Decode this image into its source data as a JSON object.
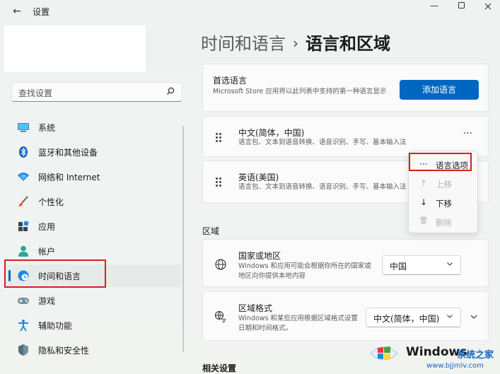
{
  "window": {
    "title": "设置",
    "back_glyph": "←",
    "min_glyph": "—"
  },
  "search": {
    "placeholder": "查找设置"
  },
  "sidebar": {
    "items": [
      {
        "label": "系统",
        "icon": "system-icon"
      },
      {
        "label": "蓝牙和其他设备",
        "icon": "bluetooth-icon"
      },
      {
        "label": "网络和 Internet",
        "icon": "wifi-icon"
      },
      {
        "label": "个性化",
        "icon": "brush-icon"
      },
      {
        "label": "应用",
        "icon": "apps-icon"
      },
      {
        "label": "帐户",
        "icon": "person-icon"
      },
      {
        "label": "时间和语言",
        "icon": "globe-clock-icon"
      },
      {
        "label": "游戏",
        "icon": "gamepad-icon"
      },
      {
        "label": "辅助功能",
        "icon": "accessibility-icon"
      },
      {
        "label": "隐私和安全性",
        "icon": "shield-icon"
      }
    ],
    "active_index": 6
  },
  "header": {
    "parent": "时间和语言",
    "separator": "›",
    "current": "语言和区域"
  },
  "preferred": {
    "title": "首选语言",
    "description": "Microsoft Store 应用将以此列表中支持的第一种语言显示",
    "add_button": "添加语言"
  },
  "languages": [
    {
      "name": "中文(简体，中国)",
      "features": "语言包、文本到语音转换、语音识别、手写、基本输入法"
    },
    {
      "name": "英语(美国)",
      "features": "语言包、文本到语音转换、语音识别、手写、基本输入法"
    }
  ],
  "more_glyph": "···",
  "context_menu": {
    "items": [
      {
        "label": "语言选项",
        "glyph": "···",
        "enabled": true
      },
      {
        "label": "上移",
        "glyph": "↑",
        "enabled": false
      },
      {
        "label": "下移",
        "glyph": "↓",
        "enabled": true
      },
      {
        "label": "删除",
        "glyph": "🗑",
        "enabled": false
      }
    ]
  },
  "region": {
    "section_label": "区域",
    "country": {
      "title": "国家或地区",
      "description": "Windows 和应用可能会根据你所在的国家或地区向你提供本地内容",
      "value": "中国"
    },
    "format": {
      "title": "区域格式",
      "description": "Windows 和某些应用根据区域格式设置日期和时间格式。",
      "value": "中文(简体，中国)"
    }
  },
  "related": {
    "label": "相关设置"
  },
  "watermark": {
    "brand": "Windows",
    "brand_cn": "系统之家",
    "url": "www.bjjmlv.com"
  },
  "colors": {
    "accent": "#0067c0",
    "highlight": "#d42020"
  }
}
